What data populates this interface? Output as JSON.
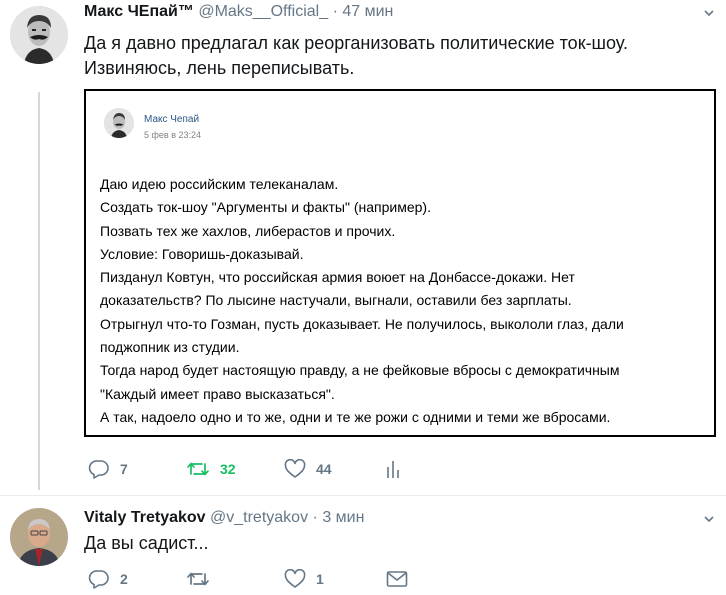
{
  "tweets": [
    {
      "name": "Макс ЧЕпай™",
      "handle": "@Maks__Official_",
      "separator": "·",
      "time": "47 мин",
      "text_lines": [
        "Да я давно предлагал как реорганизовать политические ток-шоу.",
        "Извиняюсь, лень переписывать."
      ],
      "quoted_post": {
        "author": "Макс Чепай",
        "date": "5 фев в 23:24",
        "lines": [
          "Даю идею российским телеканалам.",
          "Создать ток-шоу \"Аргументы и факты\" (например).",
          "Позвать тех же хахлов, либерастов и прочих.",
          "Условие: Говоришь-доказывай.",
          "Пизданул Ковтун, что российская армия воюет на Донбассе-докажи. Нет",
          "доказательств? По лысине настучали, выгнали, оставили без зарплаты.",
          "Отрыгнул что-то Гозман, пусть доказывает. Не получилось, выкололи глаз, дали",
          "поджопник из студии.",
          "Тогда народ будет настоящую правду, а не фейковые вбросы с демократичным",
          "\"Каждый имеет право высказаться\".",
          "А так, надоело одно и то же, одни и те же рожи с одними и теми же вбросами."
        ]
      },
      "actions": {
        "replies": "7",
        "retweets": "32",
        "likes": "44",
        "analytics_icon": "bar-chart-icon"
      }
    },
    {
      "name": "Vitaly Tretyakov",
      "handle": "@v_tretyakov",
      "separator": "·",
      "time": "3 мин",
      "text_lines": [
        "Да вы садист..."
      ],
      "actions": {
        "replies": "2",
        "retweets": "",
        "likes": "1",
        "dm_icon": "envelope-icon"
      }
    }
  ],
  "colors": {
    "text": "#14171a",
    "secondary": "#657786",
    "retweet_active": "#17bf63",
    "vk_link": "#2a5885",
    "thread_line": "#cfd9de"
  }
}
